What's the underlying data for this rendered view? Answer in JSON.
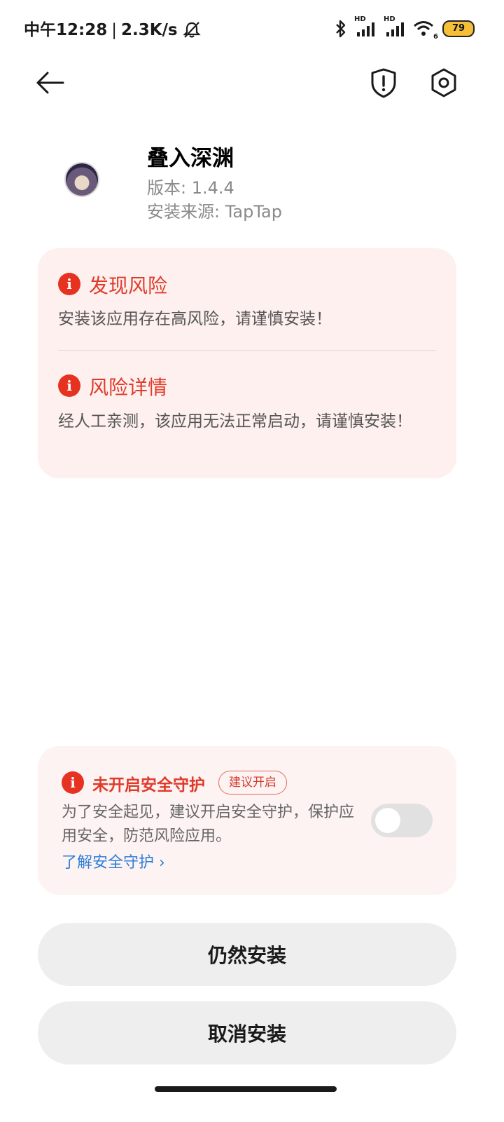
{
  "status": {
    "time": "中午12:28",
    "speed": "2.3K/s",
    "battery": "79",
    "signal_label_1": "HD",
    "signal_label_2": "HD",
    "wifi_sub": "6"
  },
  "icons": {
    "back": "arrow-left-icon",
    "shield": "shield-alert-icon",
    "settings": "gear-icon",
    "risk": "info-icon"
  },
  "app": {
    "name": "叠入深渊",
    "version": "版本: 1.4.4",
    "source": "安装来源: TapTap"
  },
  "risk": {
    "found_title": "发现风险",
    "found_text": "安装该应用存在高风险，请谨慎安装！",
    "detail_title": "风险详情",
    "detail_text": "经人工亲测，该应用无法正常启动，请谨慎安装！"
  },
  "protection": {
    "title": "未开启安全守护",
    "badge": "建议开启",
    "text": "为了安全起见，建议开启安全守护，保护应用安全，防范风险应用。",
    "link": "了解安全守护 ›",
    "toggle_on": false
  },
  "buttons": {
    "install_anyway": "仍然安装",
    "cancel_install": "取消安装"
  },
  "colors": {
    "accent_red": "#e63221",
    "link_blue": "#2f7fd8",
    "card_bg": "#fdf0ee"
  }
}
